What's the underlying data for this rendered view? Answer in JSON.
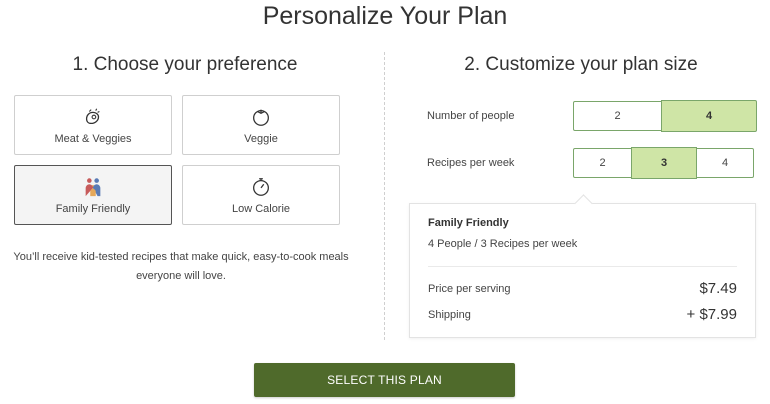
{
  "page": {
    "title": "Personalize Your Plan"
  },
  "preferences": {
    "heading": "1. Choose your preference",
    "cards": [
      {
        "label": "Meat & Veggies",
        "icon": "meat-icon",
        "selected": false
      },
      {
        "label": "Veggie",
        "icon": "tomato-icon",
        "selected": false
      },
      {
        "label": "Family Friendly",
        "icon": "family-icon",
        "selected": true
      },
      {
        "label": "Low Calorie",
        "icon": "timer-icon",
        "selected": false
      }
    ],
    "description_line1": "You’ll receive kid-tested recipes that make quick, easy-to-cook meals",
    "description_line2": "everyone will love."
  },
  "plan_size": {
    "heading": "2. Customize your plan size",
    "people": {
      "label": "Number of people",
      "options": [
        "2",
        "4"
      ],
      "selected": "4"
    },
    "recipes": {
      "label": "Recipes per week",
      "options": [
        "2",
        "3",
        "4"
      ],
      "selected": "3"
    }
  },
  "summary": {
    "title": "Family Friendly",
    "subtitle": "4 People / 3 Recipes per week",
    "price_label": "Price per serving",
    "price_value": "$7.49",
    "shipping_label": "Shipping",
    "shipping_value": "+ $7.99"
  },
  "cta": {
    "label": "SELECT THIS PLAN"
  },
  "colors": {
    "accent_green": "#4f6a2b",
    "selected_segment": "#cfe5a6",
    "segment_border": "#7aa66a"
  }
}
